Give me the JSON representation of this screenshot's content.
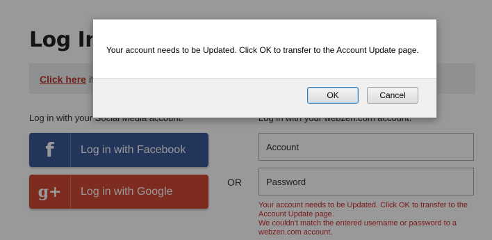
{
  "page": {
    "title": "Log In",
    "notice": {
      "link_text": "Click here",
      "text": "if"
    },
    "social_label": "Log in with your Social Media account.",
    "site_label": "Log in with your webzen.com account.",
    "facebook": {
      "icon_glyph": "f",
      "label": "Log in with Facebook",
      "color": "#3b5998"
    },
    "google": {
      "icon_glyph": "g+",
      "label": "Log in with Google",
      "color": "#d34836"
    },
    "or_text": "OR",
    "account_placeholder": "Account",
    "password_placeholder": "Password",
    "errors": {
      "line1": "Your account needs to be Updated. Click OK to transfer to the Account Update page.",
      "line2": "We couldn't match the entered username or password to a webzen.com account."
    }
  },
  "dialog": {
    "message": "Your account needs to be Updated. Click OK to transfer to the Account Update page.",
    "ok_label": "OK",
    "cancel_label": "Cancel"
  },
  "colors": {
    "error": "#cc2b2b",
    "link": "#c0392b"
  }
}
